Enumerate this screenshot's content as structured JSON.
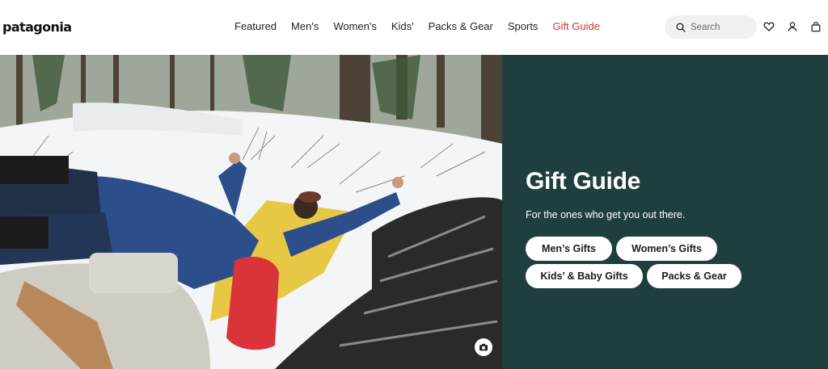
{
  "brand": {
    "logo_text": "patagonia"
  },
  "nav": {
    "items": [
      {
        "label": "Featured"
      },
      {
        "label": "Men's"
      },
      {
        "label": "Women's"
      },
      {
        "label": "Kids'"
      },
      {
        "label": "Packs & Gear"
      },
      {
        "label": "Sports"
      },
      {
        "label": "Gift Guide"
      }
    ],
    "accent_color": "#d13c2f"
  },
  "search": {
    "placeholder": "Search",
    "icon": "search-icon"
  },
  "header_icons": [
    "heart-icon",
    "account-icon",
    "bag-icon"
  ],
  "hero": {
    "panel_color": "#1f3f3f",
    "title": "Gift Guide",
    "subtitle": "For the ones who get you out there.",
    "buttons": [
      {
        "label": "Men’s Gifts"
      },
      {
        "label": "Women’s Gifts"
      },
      {
        "label": "Kids’ & Baby Gifts"
      },
      {
        "label": "Packs & Gear"
      }
    ],
    "image_icon": "camera-icon"
  }
}
